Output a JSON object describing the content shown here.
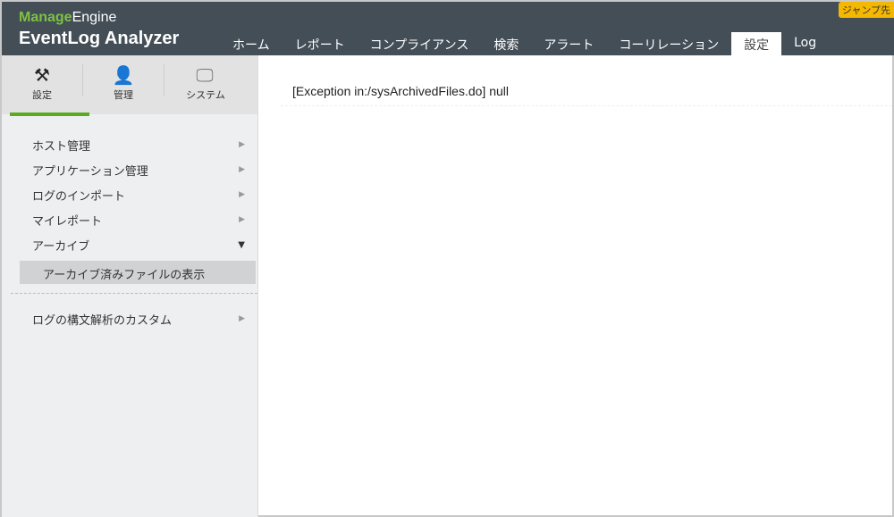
{
  "header": {
    "brand_top_a": "Manage",
    "brand_top_b": "Engine",
    "brand_product": "EventLog Analyzer",
    "jump_label": "ジャンプ先",
    "nav": [
      {
        "label": "ホーム"
      },
      {
        "label": "レポート"
      },
      {
        "label": "コンプライアンス"
      },
      {
        "label": "検索"
      },
      {
        "label": "アラート"
      },
      {
        "label": "コーリレーション"
      },
      {
        "label": "設定",
        "active": true
      },
      {
        "label": "Log"
      }
    ]
  },
  "sidebar": {
    "tabs": [
      {
        "label": "設定",
        "icon": "tools-icon"
      },
      {
        "label": "管理",
        "icon": "user-gear-icon"
      },
      {
        "label": "システム",
        "icon": "monitor-gear-icon"
      }
    ],
    "items": [
      {
        "label": "ホスト管理"
      },
      {
        "label": "アプリケーション管理"
      },
      {
        "label": "ログのインポート"
      },
      {
        "label": "マイレポート"
      },
      {
        "label": "アーカイブ"
      }
    ],
    "sub_item": "アーカイブ済みファイルの表示",
    "extra_item": "ログの構文解析のカスタム"
  },
  "main": {
    "message": "[Exception in:/sysArchivedFiles.do] null"
  }
}
